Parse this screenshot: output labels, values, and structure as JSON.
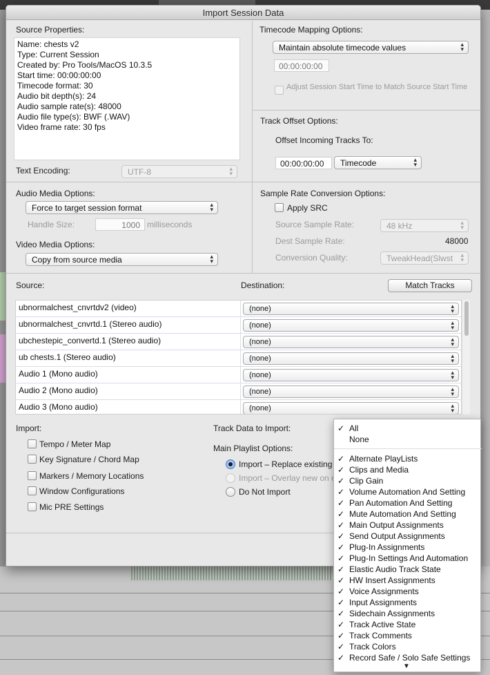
{
  "window": {
    "title": "Import Session Data"
  },
  "source_properties": {
    "heading": "Source Properties:",
    "lines": [
      "Name: chests v2",
      "Type: Current Session",
      "Created by: Pro Tools/MacOS 10.3.5",
      "Start time: 00:00:00:00",
      "Timecode format: 30",
      "Audio bit depth(s): 24",
      "Audio sample rate(s): 48000",
      "Audio file type(s): BWF (.WAV)",
      "Video frame rate: 30 fps"
    ],
    "text_encoding_label": "Text Encoding:",
    "text_encoding_value": "UTF-8"
  },
  "timecode_mapping": {
    "heading": "Timecode Mapping Options:",
    "mode": "Maintain absolute timecode values",
    "timecode": "00:00:00:00",
    "adjust_label": "Adjust Session Start Time to Match Source Start Time"
  },
  "track_offset": {
    "heading": "Track Offset Options:",
    "offset_label": "Offset Incoming Tracks To:",
    "offset_value": "00:00:00:00",
    "offset_unit": "Timecode"
  },
  "audio_media": {
    "heading": "Audio Media Options:",
    "mode": "Force to target session format",
    "handle_label": "Handle Size:",
    "handle_value": "1000",
    "handle_unit": "milliseconds"
  },
  "video_media": {
    "heading": "Video Media Options:",
    "mode": "Copy from source media"
  },
  "sample_rate": {
    "heading": "Sample Rate Conversion Options:",
    "apply_label": "Apply SRC",
    "source_label": "Source Sample Rate:",
    "source_value": "48 kHz",
    "dest_label": "Dest Sample Rate:",
    "dest_value": "48000",
    "quality_label": "Conversion Quality:",
    "quality_value": "TweakHead(Slwst"
  },
  "tracks": {
    "source_header": "Source:",
    "destination_header": "Destination:",
    "match_button": "Match Tracks",
    "rows": [
      {
        "source": "ubnormalchest_cnvrtdv2 (video)",
        "destination": "(none)"
      },
      {
        "source": "ubnormalchest_cnvrtd.1 (Stereo audio)",
        "destination": "(none)"
      },
      {
        "source": "ubchestepic_convertd.1 (Stereo audio)",
        "destination": "(none)"
      },
      {
        "source": "ub chests.1 (Stereo audio)",
        "destination": "(none)"
      },
      {
        "source": "Audio 1 (Mono audio)",
        "destination": "(none)"
      },
      {
        "source": "Audio 2 (Mono audio)",
        "destination": "(none)"
      },
      {
        "source": "Audio 3 (Mono audio)",
        "destination": "(none)"
      }
    ]
  },
  "import": {
    "heading": "Import:",
    "options": [
      "Tempo / Meter Map",
      "Key Signature / Chord Map",
      "Markers / Memory Locations",
      "Window Configurations",
      "Mic PRE Settings"
    ]
  },
  "track_data": {
    "heading": "Track Data to Import:",
    "playlist_heading": "Main Playlist Options:",
    "playlist_options": [
      {
        "label": "Import – Replace existing",
        "selected": true,
        "enabled": true
      },
      {
        "label": "Import – Overlay new on e",
        "selected": false,
        "enabled": false
      },
      {
        "label": "Do Not Import",
        "selected": false,
        "enabled": true
      }
    ]
  },
  "track_data_menu": {
    "top_items": [
      {
        "label": "All",
        "checked": true
      },
      {
        "label": "None",
        "checked": false
      }
    ],
    "items": [
      {
        "label": "Alternate PlayLists",
        "checked": true
      },
      {
        "label": "Clips and Media",
        "checked": true
      },
      {
        "label": "Clip Gain",
        "checked": true
      },
      {
        "label": "Volume Automation And Setting",
        "checked": true
      },
      {
        "label": "Pan Automation And Setting",
        "checked": true
      },
      {
        "label": "Mute Automation And Setting",
        "checked": true
      },
      {
        "label": "Main Output Assignments",
        "checked": true
      },
      {
        "label": "Send Output Assignments",
        "checked": true
      },
      {
        "label": "Plug-In Assignments",
        "checked": true
      },
      {
        "label": "Plug-In Settings And Automation",
        "checked": true
      },
      {
        "label": "Elastic Audio Track State",
        "checked": true
      },
      {
        "label": "HW Insert Assignments",
        "checked": true
      },
      {
        "label": "Voice Assignments",
        "checked": true
      },
      {
        "label": "Input Assignments",
        "checked": true
      },
      {
        "label": "Sidechain Assignments",
        "checked": true
      },
      {
        "label": "Track Active State",
        "checked": true
      },
      {
        "label": "Track Comments",
        "checked": true
      },
      {
        "label": "Track Colors",
        "checked": true
      },
      {
        "label": "Record Safe / Solo Safe Settings",
        "checked": true
      }
    ],
    "check_glyph": "✓",
    "more_glyph": "▼"
  }
}
